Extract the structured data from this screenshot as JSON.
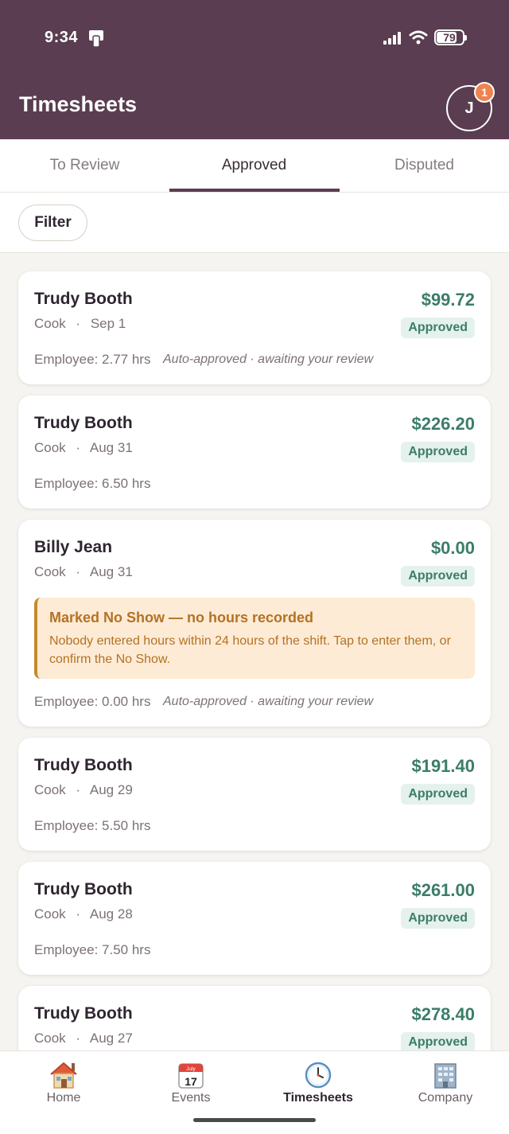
{
  "status_bar": {
    "time": "9:34",
    "battery": "79",
    "battery_level": 0.79
  },
  "header": {
    "title": "Timesheets",
    "avatar_initial": "J",
    "notification_count": "1"
  },
  "tabs": [
    {
      "label": "To Review",
      "active": false
    },
    {
      "label": "Approved",
      "active": true
    },
    {
      "label": "Disputed",
      "active": false
    }
  ],
  "filter": {
    "label": "Filter"
  },
  "timesheets": [
    {
      "name": "Trudy Booth",
      "role": "Cook",
      "separator": "·",
      "date": "Sep 1",
      "amount": "$99.72",
      "status": "Approved",
      "hours": "Employee: 2.77 hrs",
      "note": "Auto-approved · awaiting your review"
    },
    {
      "name": "Trudy Booth",
      "role": "Cook",
      "separator": "·",
      "date": "Aug 31",
      "amount": "$226.20",
      "status": "Approved",
      "hours": "Employee: 6.50 hrs"
    },
    {
      "name": "Billy Jean",
      "role": "Cook",
      "separator": "·",
      "date": "Aug 31",
      "amount": "$0.00",
      "status": "Approved",
      "hours": "Employee: 0.00 hrs",
      "note": "Auto-approved · awaiting your review",
      "alert": {
        "title": "Marked No Show — no hours recorded",
        "body": "Nobody entered hours within 24 hours of the shift. Tap to enter them, or confirm the No Show."
      }
    },
    {
      "name": "Trudy Booth",
      "role": "Cook",
      "separator": "·",
      "date": "Aug 29",
      "amount": "$191.40",
      "status": "Approved",
      "hours": "Employee: 5.50 hrs"
    },
    {
      "name": "Trudy Booth",
      "role": "Cook",
      "separator": "·",
      "date": "Aug 28",
      "amount": "$261.00",
      "status": "Approved",
      "hours": "Employee: 7.50 hrs"
    },
    {
      "name": "Trudy Booth",
      "role": "Cook",
      "separator": "·",
      "date": "Aug 27",
      "amount": "$278.40",
      "status": "Approved"
    }
  ],
  "bottom_nav": [
    {
      "label": "Home",
      "icon": "home-icon"
    },
    {
      "label": "Events",
      "icon": "calendar-icon",
      "month": "July",
      "day": "17"
    },
    {
      "label": "Timesheets",
      "icon": "clock-icon",
      "active": true
    },
    {
      "label": "Company",
      "icon": "building-icon"
    }
  ],
  "colors": {
    "header": "#5a3d50",
    "amount": "#3b7d6a",
    "status_bg": "#e5f1ec",
    "alert_bg": "#fdebd6",
    "alert_text": "#b47223"
  }
}
